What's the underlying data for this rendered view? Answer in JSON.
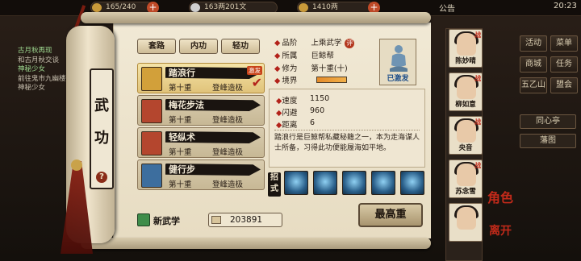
{
  "topbar": {
    "stamina": "165/240",
    "silver": "163两201文",
    "gold": "1410两",
    "notice": "公告",
    "time": "20:23"
  },
  "left_log": {
    "lines": [
      "古月秋再现",
      "和古月秋交谈",
      "神秘少女",
      "前往鬼市九幽楼",
      "神秘少女"
    ]
  },
  "panel": {
    "title_chars": [
      "武",
      "功"
    ],
    "help": "?",
    "tabs": [
      "套路",
      "内功",
      "轻功"
    ],
    "skills": [
      {
        "name": "踏浪行",
        "level": "第十重",
        "rank": "登峰造极",
        "tag": "激发",
        "selected": true,
        "color": "#d2a03a"
      },
      {
        "name": "梅花步法",
        "level": "第十重",
        "rank": "登峰造极",
        "tag": "",
        "selected": false,
        "color": "#b4462e"
      },
      {
        "name": "轻纵术",
        "level": "第十重",
        "rank": "登峰造极",
        "tag": "",
        "selected": false,
        "color": "#b4462e"
      },
      {
        "name": "健行步",
        "level": "第十重",
        "rank": "登峰造极",
        "tag": "",
        "selected": false,
        "color": "#3d6e9e"
      }
    ],
    "new_skill": "新武学",
    "points": "203891"
  },
  "detail": {
    "rows": [
      {
        "label": "品阶",
        "value": "上乘武学"
      },
      {
        "label": "所属",
        "value": "巨鲸帮"
      },
      {
        "label": "修为",
        "value": "第十重(十)"
      },
      {
        "label": "境界",
        "value": ""
      }
    ],
    "grade_badge": "评",
    "realm_progress": 1.0,
    "portrait_caption": "已激发",
    "stats": [
      {
        "label": "速度",
        "value": "1150"
      },
      {
        "label": "闪避",
        "value": "960"
      },
      {
        "label": "距离",
        "value": "6"
      }
    ],
    "description": "踏浪行是巨鲸帮私藏秘籍之一，本为走海谋人士所备，习得此功便能履海如平地。",
    "moves_label": "招式",
    "move_icons": [
      "move-icon-1",
      "move-icon-2",
      "move-icon-3",
      "move-icon-4",
      "move-icon-5"
    ],
    "max_button": "最高重"
  },
  "characters": [
    {
      "name": "陈妙晴",
      "tag": "战"
    },
    {
      "name": "柳如意",
      "tag": "战"
    },
    {
      "name": "央音",
      "tag": "战"
    },
    {
      "name": "苏念雪",
      "tag": "战"
    },
    {
      "name": "",
      "tag": ""
    }
  ],
  "side_labels": {
    "role": "角色",
    "leave": "离开"
  },
  "right_menu": {
    "row1": [
      "活动",
      "菜单"
    ],
    "row2": [
      "商城",
      "任务"
    ],
    "row3": [
      "五乙山",
      "盟会"
    ],
    "btn1": "同心亭",
    "btn2": "藩图"
  }
}
